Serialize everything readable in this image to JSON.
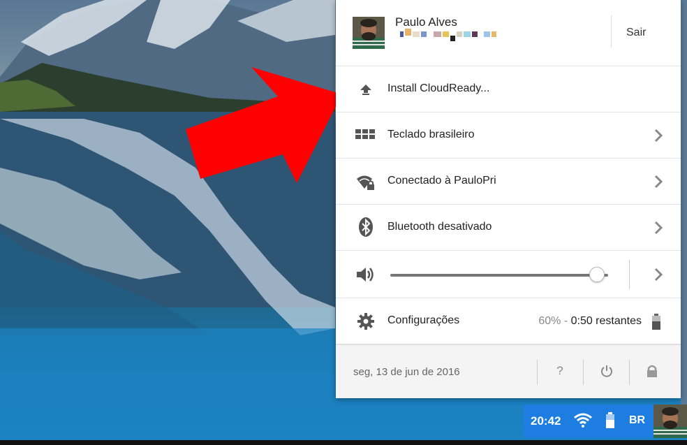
{
  "user": {
    "name": "Paulo Alves",
    "sign_out_label": "Sair"
  },
  "menu": {
    "install_label": "Install CloudReady...",
    "keyboard_label": "Teclado brasileiro",
    "network_label": "Conectado à PauloPri",
    "bluetooth_label": "Bluetooth desativado",
    "volume_level": 0.95,
    "settings_label": "Configurações",
    "battery_percent": "60%",
    "battery_separator": " - ",
    "battery_remaining": "0:50 restantes"
  },
  "footer": {
    "date": "seg, 13 de jun de 2016",
    "help_label": "?"
  },
  "tray": {
    "time": "20:42",
    "keyboard_layout": "BR"
  },
  "icons": {
    "install": "upload-arrow-icon",
    "keyboard": "keyboard-icon",
    "wifi": "wifi-lock-icon",
    "bluetooth": "bluetooth-icon",
    "volume": "speaker-icon",
    "settings": "gear-icon",
    "battery": "battery-icon",
    "power": "power-icon",
    "lock": "lock-icon"
  },
  "colors": {
    "tray_bg": "#1e7de0",
    "arrow": "#ff0000",
    "popup_bg": "#ffffff",
    "footer_bg": "#f4f4f4"
  }
}
